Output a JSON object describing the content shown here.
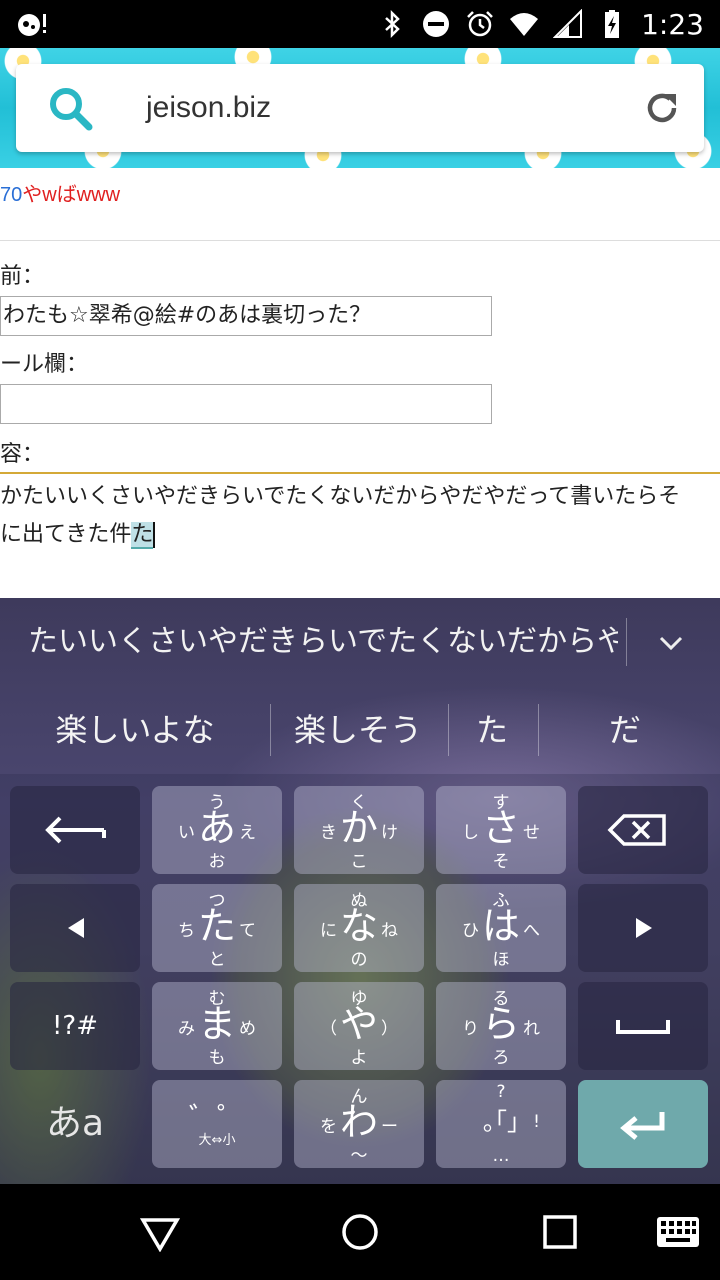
{
  "status_bar": {
    "time": "1:23",
    "icons": [
      "debug-icon",
      "bluetooth-icon",
      "do-not-disturb-icon",
      "alarm-icon",
      "wifi-icon",
      "signal-icon",
      "battery-charging-icon"
    ]
  },
  "browser": {
    "url": "jeison.biz",
    "search_icon": "search-icon",
    "reload_icon": "reload-icon",
    "accent_color": "#2ab7c4"
  },
  "page": {
    "top_link_number": "70",
    "top_link_text": "やwばwww",
    "name_label": "前：",
    "name_value": "わたも☆翠希@絵#のあは裏切った？",
    "mail_label": "ール欄：",
    "mail_value": "",
    "content_label": "容：",
    "content_line1": "かたいいくさいやだきらいでたくないだからやだやだって書いたらそ",
    "content_line2_prefix": "に出てきた件",
    "content_composing": "た"
  },
  "keyboard": {
    "composition": "たいいくさいやだきらいでたくないだからやだや",
    "candidates": [
      "楽しいよな",
      "楽しそう",
      "た",
      "だ"
    ],
    "keys": {
      "a": {
        "main": "あ",
        "up": "う",
        "left": "い",
        "right": "え",
        "down": "お"
      },
      "ka": {
        "main": "か",
        "up": "く",
        "left": "き",
        "right": "け",
        "down": "こ"
      },
      "sa": {
        "main": "さ",
        "up": "す",
        "left": "し",
        "right": "せ",
        "down": "そ"
      },
      "ta": {
        "main": "た",
        "up": "つ",
        "left": "ち",
        "right": "て",
        "down": "と"
      },
      "na": {
        "main": "な",
        "up": "ぬ",
        "left": "に",
        "right": "ね",
        "down": "の"
      },
      "ha": {
        "main": "は",
        "up": "ふ",
        "left": "ひ",
        "right": "へ",
        "down": "ほ"
      },
      "ma": {
        "main": "ま",
        "up": "む",
        "left": "み",
        "right": "め",
        "down": "も"
      },
      "ya": {
        "main": "や",
        "up": "ゆ",
        "left": "（",
        "right": "）",
        "down": "よ"
      },
      "ra": {
        "main": "ら",
        "up": "る",
        "left": "り",
        "right": "れ",
        "down": "ろ"
      },
      "wa": {
        "main": "わ",
        "up": "ん",
        "left": "を",
        "right": "ー",
        "down": "～"
      },
      "dakuten": {
        "main": "゛゜",
        "down": "大⇔小"
      },
      "punct": {
        "main": "｡｢｣",
        "up": "?",
        "right": "!",
        "down": "…"
      },
      "symbols": "!?#",
      "mode": "あa"
    }
  },
  "nav": {
    "icons": [
      "back-icon",
      "home-icon",
      "recents-icon",
      "keyboard-switch-icon"
    ]
  }
}
